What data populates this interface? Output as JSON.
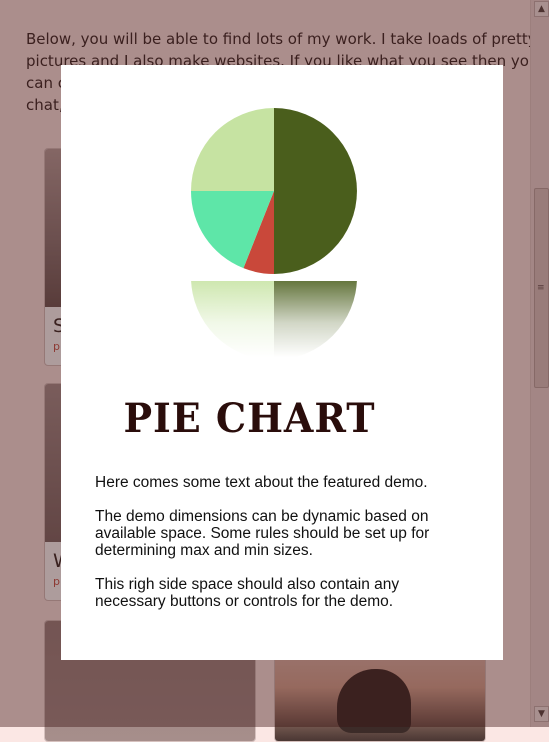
{
  "background": {
    "intro_lines": [
      "Below, you will be able to find lots of my work. I take loads of pretty",
      "pictures and I also make websites. If you like what you see then you",
      "can c",
      "chat,"
    ],
    "cards": [
      {
        "title": "S",
        "subtitle": "p"
      },
      {
        "title": "W",
        "subtitle": "p"
      },
      {
        "title": "",
        "subtitle": ""
      },
      {
        "title": "",
        "subtitle": ""
      }
    ]
  },
  "scrollbar": {
    "up_glyph": "▲",
    "down_glyph": "▼",
    "grip_glyph": "≡"
  },
  "modal": {
    "title": "PIE CHART",
    "paragraphs": [
      [
        "Here comes some text about the featured demo."
      ],
      [
        "The demo dimensions can be dynamic based on",
        "available space. Some rules should be set up for",
        "determining max  and min sizes."
      ],
      [
        "This righ side space should also contain any",
        "necessary buttons or controls for the demo."
      ]
    ]
  },
  "chart_data": {
    "type": "pie",
    "categories": [
      "dark green",
      "red",
      "mint green",
      "light green"
    ],
    "values": [
      50,
      6,
      19,
      25
    ],
    "colors": [
      "#4a5e1c",
      "#c9483a",
      "#5ee6a8",
      "#c6e3a2"
    ],
    "reflection": true,
    "title": "",
    "xlabel": "",
    "ylabel": ""
  }
}
